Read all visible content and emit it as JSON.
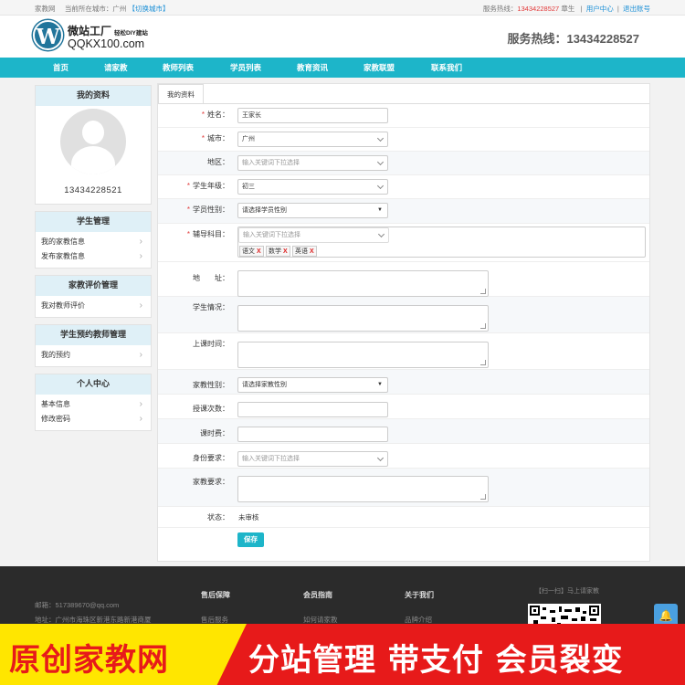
{
  "topbar": {
    "site": "家教网",
    "city_prefix": "当前所在城市：",
    "city": "广州",
    "switch_city": "【切换城市】",
    "hotline_prefix": "服务热线：",
    "hotline": "13434228527",
    "user": "章生",
    "user_center": "用户中心",
    "logout": "退出账号"
  },
  "header": {
    "logo_letter": "W",
    "logo_cn": "微站工厂",
    "logo_slogan": "轻松DIY建站",
    "logo_en": "QQKX100.com",
    "hotline_label": "服务热线：",
    "hotline": "13434228527"
  },
  "nav": [
    "首页",
    "请家教",
    "教师列表",
    "学员列表",
    "教育资讯",
    "家教联盟",
    "联系我们"
  ],
  "sidebar": {
    "profile_title": "我的资料",
    "phone": "13434228521",
    "groups": [
      {
        "title": "学生管理",
        "items": [
          "我的家教信息",
          "发布家教信息"
        ]
      },
      {
        "title": "家教评价管理",
        "items": [
          "我对教师评价"
        ]
      },
      {
        "title": "学生预约教师管理",
        "items": [
          "我的预约"
        ]
      },
      {
        "title": "个人中心",
        "items": [
          "基本信息",
          "修改密码"
        ]
      }
    ]
  },
  "form": {
    "tab": "我的资料",
    "name_label": "姓名：",
    "name_value": "王家长",
    "city_label": "城市：",
    "city_value": "广州",
    "area_label": "地区：",
    "area_placeholder": "输入关键词下拉选择",
    "grade_label": "学生年级：",
    "grade_value": "初三",
    "gender_label": "学员性别：",
    "gender_value": "请选择学员性别",
    "subject_label": "辅导科目：",
    "subject_placeholder": "输入关键词下拉选择",
    "subject_tags": [
      "语文",
      "数学",
      "英语"
    ],
    "tag_remove": "X",
    "address_label": "地　　址：",
    "situation_label": "学生情况：",
    "time_label": "上课时间：",
    "teacher_gender_label": "家教性别：",
    "teacher_gender_value": "请选择家教性别",
    "times_label": "授课次数：",
    "fee_label": "课时费：",
    "identity_label": "身份要求：",
    "identity_placeholder": "输入关键词下拉选择",
    "requirement_label": "家教要求：",
    "status_label": "状态：",
    "status_value": "未审核",
    "save": "保存"
  },
  "footer": {
    "email": "邮箱：517389670@qq.com",
    "address": "地址：广州市海珠区新港东路新港商厦",
    "col1_title": "售后保障",
    "col1_item": "售后服务",
    "col2_title": "会员指南",
    "col2_item": "如何请家教",
    "col3_title": "关于我们",
    "col3_item": "品牌介绍",
    "qr_caption": "【扫一扫】马上请家教"
  },
  "banner": {
    "left": "原创家教网",
    "right": "分站管理 带支付 会员裂变"
  },
  "colors": {
    "accent": "#1db5c9",
    "red": "#e71a1a",
    "yellow": "#ffe600"
  }
}
